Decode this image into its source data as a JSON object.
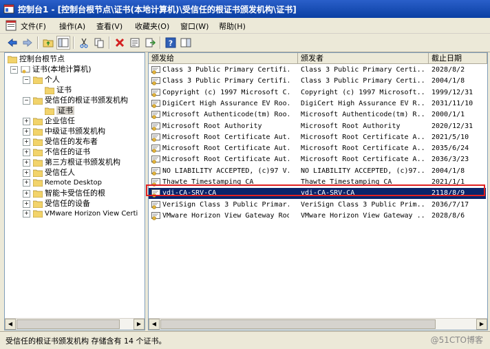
{
  "window": {
    "title": "控制台1 - [控制台根节点\\证书(本地计算机)\\受信任的根证书颁发机构\\证书]"
  },
  "menu": [
    "文件(F)",
    "操作(A)",
    "查看(V)",
    "收藏夹(O)",
    "窗口(W)",
    "帮助(H)"
  ],
  "toolbar": [
    "back-icon",
    "forward-icon",
    "up-folder-icon",
    "show-tree-icon",
    "cut-icon",
    "copy-icon",
    "delete-icon",
    "properties-icon",
    "export-icon",
    "help-icon",
    "panel-icon"
  ],
  "tree": [
    {
      "label": "控制台根节点"
    },
    {
      "label": "证书(本地计算机)"
    },
    {
      "label": "个人"
    },
    {
      "label": "证书"
    },
    {
      "label": "受信任的根证书颁发机构"
    },
    {
      "label": "证书"
    },
    {
      "label": "企业信任"
    },
    {
      "label": "中级证书颁发机构"
    },
    {
      "label": "受信任的发布者"
    },
    {
      "label": "不信任的证书"
    },
    {
      "label": "第三方根证书颁发机构"
    },
    {
      "label": "受信任人"
    },
    {
      "label": "Remote Desktop"
    },
    {
      "label": "智能卡受信任的根"
    },
    {
      "label": "受信任的设备"
    },
    {
      "label": "VMware Horizon View Certi"
    }
  ],
  "columns": [
    "颁发给",
    "颁发者",
    "截止日期"
  ],
  "rows": [
    {
      "issued_to": "Class 3 Public Primary Certifi...",
      "issued_by": "Class 3 Public Primary Certi...",
      "expires": "2028/8/2"
    },
    {
      "issued_to": "Class 3 Public Primary Certifi...",
      "issued_by": "Class 3 Public Primary Certi...",
      "expires": "2004/1/8"
    },
    {
      "issued_to": "Copyright (c) 1997 Microsoft C...",
      "issued_by": "Copyright (c) 1997 Microsoft...",
      "expires": "1999/12/31"
    },
    {
      "issued_to": "DigiCert High Assurance EV Roo...",
      "issued_by": "DigiCert High Assurance EV R...",
      "expires": "2031/11/10"
    },
    {
      "issued_to": "Microsoft Authenticode(tm) Roo...",
      "issued_by": "Microsoft Authenticode(tm) R...",
      "expires": "2000/1/1"
    },
    {
      "issued_to": "Microsoft Root Authority",
      "issued_by": "Microsoft Root Authority",
      "expires": "2020/12/31"
    },
    {
      "issued_to": "Microsoft Root Certificate Aut...",
      "issued_by": "Microsoft Root Certificate A...",
      "expires": "2021/5/10"
    },
    {
      "issued_to": "Microsoft Root Certificate Aut...",
      "issued_by": "Microsoft Root Certificate A...",
      "expires": "2035/6/24"
    },
    {
      "issued_to": "Microsoft Root Certificate Aut...",
      "issued_by": "Microsoft Root Certificate A...",
      "expires": "2036/3/23"
    },
    {
      "issued_to": "NO LIABILITY ACCEPTED, (c)97 V...",
      "issued_by": "NO LIABILITY ACCEPTED, (c)97...",
      "expires": "2004/1/8"
    },
    {
      "issued_to": "Thawte Timestamping CA",
      "issued_by": "Thawte Timestamping CA",
      "expires": "2021/1/1"
    },
    {
      "issued_to": "vdi-CA-SRV-CA",
      "issued_by": "vdi-CA-SRV-CA",
      "expires": "2118/8/9"
    },
    {
      "issued_to": "VeriSign Class 3 Public Primar...",
      "issued_by": "VeriSign Class 3 Public Prim...",
      "expires": "2036/7/17"
    },
    {
      "issued_to": "VMware Horizon View Gateway Root",
      "issued_by": "VMware Horizon View Gateway ...",
      "expires": "2028/8/6"
    }
  ],
  "status": {
    "text": "受信任的根证书颁发机构 存储含有 14 个证书。",
    "watermark": "@51CTO博客"
  },
  "colors": {
    "title_bar": "#0a3fa3",
    "selection": "#0a246a",
    "highlight_border": "#e02020"
  }
}
